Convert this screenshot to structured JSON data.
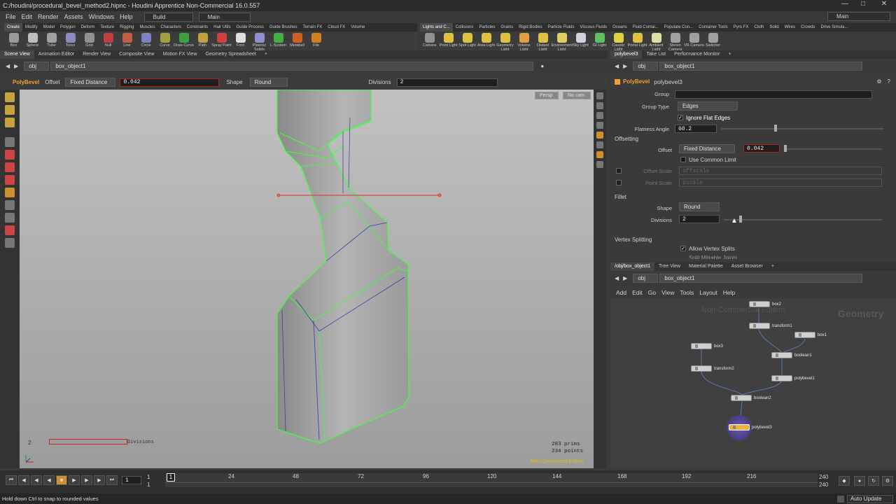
{
  "window": {
    "title": "C:/houdini/procedural_bevel_method2.hipnc - Houdini Apprentice Non-Commercial 16.0.557"
  },
  "menu": {
    "items": [
      "File",
      "Edit",
      "Render",
      "Assets",
      "Windows",
      "Help"
    ],
    "desktop_build": "Build",
    "desktop_main": "Main",
    "desktop_right": "Main"
  },
  "shelf_left": {
    "tabs": [
      "Create",
      "Modify",
      "Model",
      "Polygon",
      "Deform",
      "Texture",
      "Rigging",
      "Muscles",
      "Characters",
      "Constraints",
      "Hair Utils",
      "Guide Process",
      "Guide Brushes",
      "Terrain FX",
      "Cloud FX",
      "Volume"
    ],
    "tools": [
      "Box",
      "Sphere",
      "Tube",
      "Torus",
      "Grid",
      "Null",
      "Line",
      "Circle",
      "Curve",
      "Draw Curve",
      "Path",
      "Spray Paint",
      "Font",
      "Platonic Solids",
      "L-System",
      "Metaball",
      "File"
    ]
  },
  "shelf_right": {
    "tabs": [
      "Lights and C...",
      "Collisions",
      "Particles",
      "Grains",
      "Rigid Bodies",
      "Particle Fluids",
      "Viscous Fluids",
      "Oceans",
      "Fluid Contai...",
      "Populate Con...",
      "Container Tools",
      "Pyro FX",
      "Cloth",
      "Solid",
      "Wires",
      "Crowds",
      "Drive Simula..."
    ],
    "tools": [
      "Camera",
      "Point Light",
      "Spot Light",
      "Area Light",
      "Geometry Light",
      "Volume Light",
      "Distant Light",
      "Environment Light",
      "Sky Light",
      "GI Light",
      "Caustic Light",
      "Portal Light",
      "Ambient Light",
      "Stereo Camera",
      "VR Camera",
      "Switcher"
    ]
  },
  "left_pane": {
    "tabs": [
      "Scene View",
      "Animation Editor",
      "Render View",
      "Composite View",
      "Motion FX View",
      "Geometry Spreadsheet"
    ],
    "path_root": "obj",
    "path_node": "box_object1"
  },
  "operator_bar": {
    "tool": "PolyBevel",
    "offset_label": "Offset",
    "offset_mode": "Fixed Distance",
    "offset_value": "0.042",
    "shape_label": "Shape",
    "shape_value": "Round",
    "divisions_label": "Divisions",
    "divisions_value": "2"
  },
  "viewport": {
    "camera_menu": "Persp",
    "cam_menu": "No cam",
    "handle_value": "2",
    "handle_label": "Divisions",
    "prims": "283  prims",
    "points": "234 points",
    "watermark": "Non-Commercial Edition"
  },
  "params": {
    "tabs": [
      "polybevel3",
      "Take List",
      "Performance Monitor"
    ],
    "path_root": "obj",
    "path_node": "box_object1",
    "node_type": "PolyBevel",
    "node_name": "polybevel3",
    "group_label": "Group",
    "group_type_label": "Group Type",
    "group_type": "Edges",
    "ignore_flat": "Ignore Flat Edges",
    "flatness_label": "Flatness Angle",
    "flatness": "60.2",
    "offsetting": "Offsetting",
    "offset_label": "Offset",
    "offset_mode": "Fixed Distance",
    "offset_value": "0.042",
    "use_common": "Use Common Limit",
    "offset_scale_label": "Offset Scale",
    "offset_scale": "offscale",
    "point_scale_label": "Point Scale",
    "point_scale": "pscale",
    "fillet": "Fillet",
    "shape_label": "Shape",
    "shape": "Round",
    "divisions_label": "Divisions",
    "divisions": "2",
    "vertex_splitting": "Vertex Splitting",
    "allow_splits": "Allow Vertex Splits",
    "split_more": "Split Mitrable Joints"
  },
  "network": {
    "tabs": [
      "/obj/box_object1",
      "Tree View",
      "Material Palette",
      "Asset Browser"
    ],
    "path_root": "obj",
    "path_node": "box_object1",
    "menu": [
      "Add",
      "Edit",
      "Go",
      "View",
      "Tools",
      "Layout",
      "Help"
    ],
    "watermark": "Non-Commercial Edition",
    "context": "Geometry",
    "nodes": {
      "box2": "box2",
      "transform1": "transform1",
      "box1": "box1",
      "box3": "box3",
      "boolean1": "boolean1",
      "transform2": "transform2",
      "polybevel1": "polybevel1",
      "boolean2": "boolean2",
      "polybevel3": "polybevel3"
    }
  },
  "timeline": {
    "frame": "1",
    "start": "1",
    "start2": "1",
    "current": "1",
    "ticks": [
      "24",
      "48",
      "72",
      "96",
      "120",
      "144",
      "168",
      "192",
      "216"
    ],
    "end": "240",
    "end2": "240"
  },
  "status": {
    "message": "Hold down Ctrl to snap to rounded values",
    "auto_update": "Auto Update"
  },
  "colors": {
    "bg": "#3a3a3a",
    "viewport_top": "#c1c1c1",
    "viewport_bottom": "#9c9c9c",
    "wire": "#3dff3d",
    "accent": "#f0a030",
    "node_selected": "#f0b040"
  }
}
